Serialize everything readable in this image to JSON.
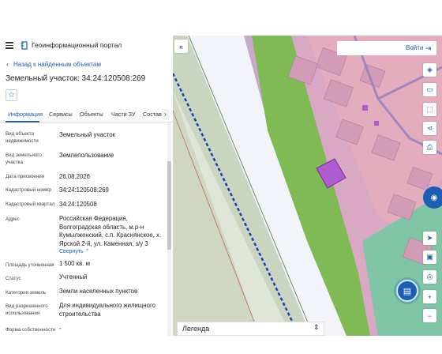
{
  "header": {
    "portal_title": "Геоинформационный портал",
    "menu_icon": "hamburger-icon",
    "logo_icon": "portal-logo-icon"
  },
  "nav": {
    "back_label": "Назад к найденным объектам"
  },
  "object": {
    "title": "Земельный участок: 34:24:120508:269"
  },
  "tabs": [
    {
      "label": "Информация",
      "active": true
    },
    {
      "label": "Сервисы",
      "active": false
    },
    {
      "label": "Объекты",
      "active": false
    },
    {
      "label": "Части ЗУ",
      "active": false
    },
    {
      "label": "Состав",
      "active": false
    }
  ],
  "properties": [
    {
      "label": "Вид объекта недвижимости",
      "value": "Земельный участок"
    },
    {
      "label": "Вид земельного участка",
      "value": "Землепользование"
    },
    {
      "label": "Дата присвоения",
      "value": "26.08.2026"
    },
    {
      "label": "Кадастровый номер",
      "value": "34:24:120508:269"
    },
    {
      "label": "Кадастровый квартал",
      "value": "34:24:120508"
    },
    {
      "label": "Адрес",
      "value": "Российская Федерация, Волгоградская область, м.р-н Кумылженский, с.п. Краснянское, х. Ярской 2-й, ул. Каменная, з/у 3",
      "extra": "Свернуть"
    },
    {
      "label": "Площадь уточненная",
      "value": "1 500 кв. м"
    },
    {
      "label": "Статус",
      "value": "Учтенный"
    },
    {
      "label": "Категория земель",
      "value": "Земли населенных пунктов"
    },
    {
      "label": "Вид разрешенного использования",
      "value": "Для индивидуального жилищного строительства"
    },
    {
      "label": "Форма собственности",
      "value": "-"
    }
  ],
  "map": {
    "login_label": "Войти",
    "legend_label": "Легенда",
    "tools": [
      "layers-icon",
      "ruler-icon",
      "area-measure-icon",
      "share-icon",
      "print-icon",
      "navigate-icon",
      "minimap-icon",
      "location-icon",
      "zoom-in-icon",
      "zoom-out-icon"
    ],
    "accent_color": "#1a5fb4",
    "selected_parcel_color": "#b15bd0"
  }
}
